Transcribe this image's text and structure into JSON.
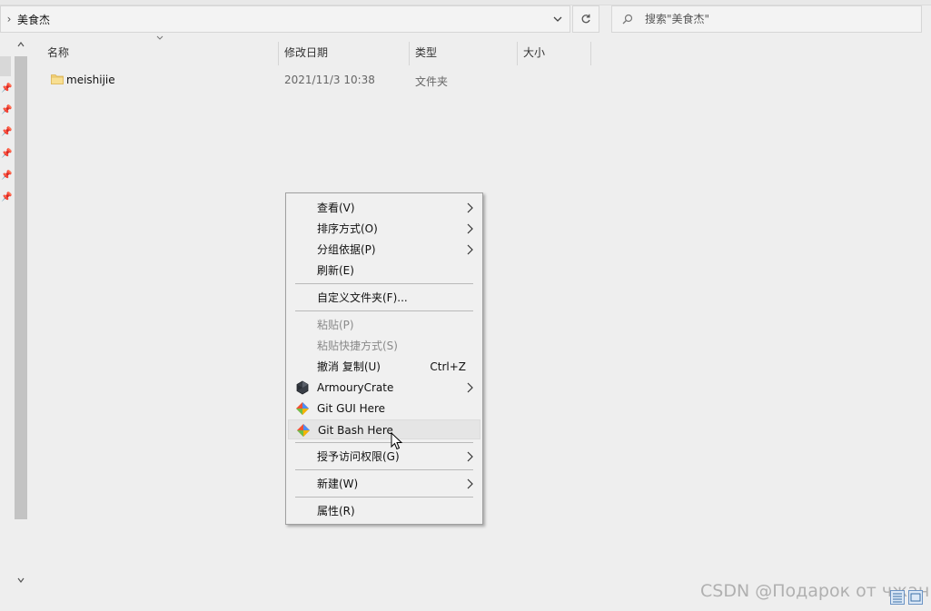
{
  "address": {
    "crumb": "美食杰"
  },
  "search": {
    "placeholder": "搜索\"美食杰\""
  },
  "columns": [
    {
      "label": "名称"
    },
    {
      "label": "修改日期"
    },
    {
      "label": "类型"
    },
    {
      "label": "大小"
    }
  ],
  "files": [
    {
      "name": "meishijie",
      "date": "2021/11/3 10:38",
      "type": "文件夹",
      "size": ""
    }
  ],
  "context_menu": {
    "items": [
      {
        "label": "查看(V)",
        "submenu": true
      },
      {
        "label": "排序方式(O)",
        "submenu": true
      },
      {
        "label": "分组依据(P)",
        "submenu": true
      },
      {
        "label": "刷新(E)"
      },
      {
        "label": "自定义文件夹(F)..."
      },
      {
        "label": "粘贴(P)",
        "disabled": true
      },
      {
        "label": "粘贴快捷方式(S)",
        "disabled": true
      },
      {
        "label": "撤消 复制(U)",
        "shortcut": "Ctrl+Z"
      },
      {
        "label": "ArmouryCrate",
        "submenu": true,
        "icon": "armoury-crate-icon"
      },
      {
        "label": "Git GUI Here",
        "icon": "git-icon"
      },
      {
        "label": "Git Bash Here",
        "icon": "git-icon",
        "hover": true
      },
      {
        "label": "授予访问权限(G)",
        "submenu": true
      },
      {
        "label": "新建(W)",
        "submenu": true
      },
      {
        "label": "属性(R)"
      }
    ]
  },
  "watermark": "CSDN @Подарок от чжан",
  "colors": {
    "background": "#eeeeee",
    "menu_bg": "#f0f0f0",
    "menu_border": "#a0a0a0",
    "folder_yellow": "#f4d27a",
    "git_red": "#f05133"
  }
}
